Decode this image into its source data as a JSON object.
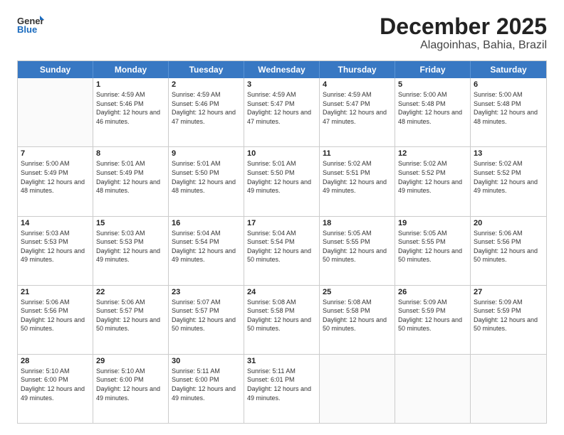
{
  "logo": {
    "general": "General",
    "blue": "Blue"
  },
  "title": "December 2025",
  "subtitle": "Alagoinhas, Bahia, Brazil",
  "header_days": [
    "Sunday",
    "Monday",
    "Tuesday",
    "Wednesday",
    "Thursday",
    "Friday",
    "Saturday"
  ],
  "weeks": [
    [
      {
        "day": "",
        "sunrise": "",
        "sunset": "",
        "daylight": "",
        "empty": true
      },
      {
        "day": "1",
        "sunrise": "Sunrise: 4:59 AM",
        "sunset": "Sunset: 5:46 PM",
        "daylight": "Daylight: 12 hours and 46 minutes."
      },
      {
        "day": "2",
        "sunrise": "Sunrise: 4:59 AM",
        "sunset": "Sunset: 5:46 PM",
        "daylight": "Daylight: 12 hours and 47 minutes."
      },
      {
        "day": "3",
        "sunrise": "Sunrise: 4:59 AM",
        "sunset": "Sunset: 5:47 PM",
        "daylight": "Daylight: 12 hours and 47 minutes."
      },
      {
        "day": "4",
        "sunrise": "Sunrise: 4:59 AM",
        "sunset": "Sunset: 5:47 PM",
        "daylight": "Daylight: 12 hours and 47 minutes."
      },
      {
        "day": "5",
        "sunrise": "Sunrise: 5:00 AM",
        "sunset": "Sunset: 5:48 PM",
        "daylight": "Daylight: 12 hours and 48 minutes."
      },
      {
        "day": "6",
        "sunrise": "Sunrise: 5:00 AM",
        "sunset": "Sunset: 5:48 PM",
        "daylight": "Daylight: 12 hours and 48 minutes."
      }
    ],
    [
      {
        "day": "7",
        "sunrise": "Sunrise: 5:00 AM",
        "sunset": "Sunset: 5:49 PM",
        "daylight": "Daylight: 12 hours and 48 minutes."
      },
      {
        "day": "8",
        "sunrise": "Sunrise: 5:01 AM",
        "sunset": "Sunset: 5:49 PM",
        "daylight": "Daylight: 12 hours and 48 minutes."
      },
      {
        "day": "9",
        "sunrise": "Sunrise: 5:01 AM",
        "sunset": "Sunset: 5:50 PM",
        "daylight": "Daylight: 12 hours and 48 minutes."
      },
      {
        "day": "10",
        "sunrise": "Sunrise: 5:01 AM",
        "sunset": "Sunset: 5:50 PM",
        "daylight": "Daylight: 12 hours and 49 minutes."
      },
      {
        "day": "11",
        "sunrise": "Sunrise: 5:02 AM",
        "sunset": "Sunset: 5:51 PM",
        "daylight": "Daylight: 12 hours and 49 minutes."
      },
      {
        "day": "12",
        "sunrise": "Sunrise: 5:02 AM",
        "sunset": "Sunset: 5:52 PM",
        "daylight": "Daylight: 12 hours and 49 minutes."
      },
      {
        "day": "13",
        "sunrise": "Sunrise: 5:02 AM",
        "sunset": "Sunset: 5:52 PM",
        "daylight": "Daylight: 12 hours and 49 minutes."
      }
    ],
    [
      {
        "day": "14",
        "sunrise": "Sunrise: 5:03 AM",
        "sunset": "Sunset: 5:53 PM",
        "daylight": "Daylight: 12 hours and 49 minutes."
      },
      {
        "day": "15",
        "sunrise": "Sunrise: 5:03 AM",
        "sunset": "Sunset: 5:53 PM",
        "daylight": "Daylight: 12 hours and 49 minutes."
      },
      {
        "day": "16",
        "sunrise": "Sunrise: 5:04 AM",
        "sunset": "Sunset: 5:54 PM",
        "daylight": "Daylight: 12 hours and 49 minutes."
      },
      {
        "day": "17",
        "sunrise": "Sunrise: 5:04 AM",
        "sunset": "Sunset: 5:54 PM",
        "daylight": "Daylight: 12 hours and 50 minutes."
      },
      {
        "day": "18",
        "sunrise": "Sunrise: 5:05 AM",
        "sunset": "Sunset: 5:55 PM",
        "daylight": "Daylight: 12 hours and 50 minutes."
      },
      {
        "day": "19",
        "sunrise": "Sunrise: 5:05 AM",
        "sunset": "Sunset: 5:55 PM",
        "daylight": "Daylight: 12 hours and 50 minutes."
      },
      {
        "day": "20",
        "sunrise": "Sunrise: 5:06 AM",
        "sunset": "Sunset: 5:56 PM",
        "daylight": "Daylight: 12 hours and 50 minutes."
      }
    ],
    [
      {
        "day": "21",
        "sunrise": "Sunrise: 5:06 AM",
        "sunset": "Sunset: 5:56 PM",
        "daylight": "Daylight: 12 hours and 50 minutes."
      },
      {
        "day": "22",
        "sunrise": "Sunrise: 5:06 AM",
        "sunset": "Sunset: 5:57 PM",
        "daylight": "Daylight: 12 hours and 50 minutes."
      },
      {
        "day": "23",
        "sunrise": "Sunrise: 5:07 AM",
        "sunset": "Sunset: 5:57 PM",
        "daylight": "Daylight: 12 hours and 50 minutes."
      },
      {
        "day": "24",
        "sunrise": "Sunrise: 5:08 AM",
        "sunset": "Sunset: 5:58 PM",
        "daylight": "Daylight: 12 hours and 50 minutes."
      },
      {
        "day": "25",
        "sunrise": "Sunrise: 5:08 AM",
        "sunset": "Sunset: 5:58 PM",
        "daylight": "Daylight: 12 hours and 50 minutes."
      },
      {
        "day": "26",
        "sunrise": "Sunrise: 5:09 AM",
        "sunset": "Sunset: 5:59 PM",
        "daylight": "Daylight: 12 hours and 50 minutes."
      },
      {
        "day": "27",
        "sunrise": "Sunrise: 5:09 AM",
        "sunset": "Sunset: 5:59 PM",
        "daylight": "Daylight: 12 hours and 50 minutes."
      }
    ],
    [
      {
        "day": "28",
        "sunrise": "Sunrise: 5:10 AM",
        "sunset": "Sunset: 6:00 PM",
        "daylight": "Daylight: 12 hours and 49 minutes."
      },
      {
        "day": "29",
        "sunrise": "Sunrise: 5:10 AM",
        "sunset": "Sunset: 6:00 PM",
        "daylight": "Daylight: 12 hours and 49 minutes."
      },
      {
        "day": "30",
        "sunrise": "Sunrise: 5:11 AM",
        "sunset": "Sunset: 6:00 PM",
        "daylight": "Daylight: 12 hours and 49 minutes."
      },
      {
        "day": "31",
        "sunrise": "Sunrise: 5:11 AM",
        "sunset": "Sunset: 6:01 PM",
        "daylight": "Daylight: 12 hours and 49 minutes."
      },
      {
        "day": "",
        "sunrise": "",
        "sunset": "",
        "daylight": "",
        "empty": true
      },
      {
        "day": "",
        "sunrise": "",
        "sunset": "",
        "daylight": "",
        "empty": true
      },
      {
        "day": "",
        "sunrise": "",
        "sunset": "",
        "daylight": "",
        "empty": true
      }
    ]
  ]
}
